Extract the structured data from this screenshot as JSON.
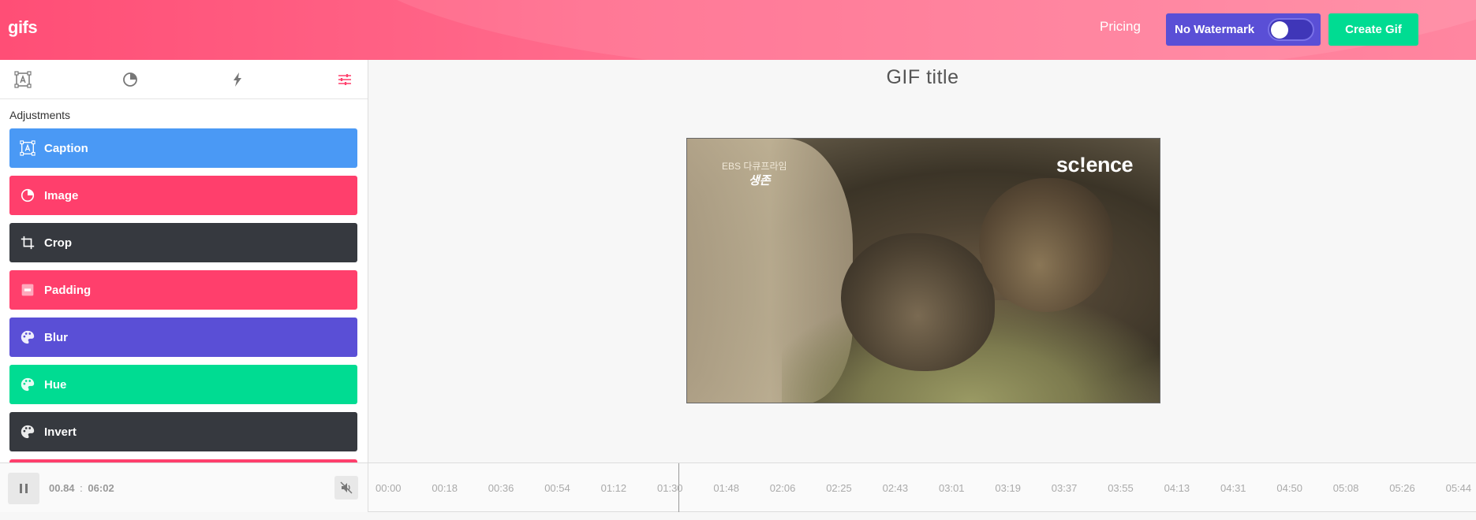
{
  "header": {
    "logo": "gifs",
    "pricing_label": "Pricing",
    "no_watermark_label": "No Watermark",
    "create_label": "Create Gif",
    "toggle_on": false
  },
  "sidebar": {
    "tabs": [
      {
        "name": "caption-tab",
        "icon": "text-box-icon",
        "active": false
      },
      {
        "name": "image-tab",
        "icon": "pie-icon",
        "active": false
      },
      {
        "name": "effects-tab",
        "icon": "lightning-icon",
        "active": false
      },
      {
        "name": "adjustments-tab",
        "icon": "sliders-icon",
        "active": true
      }
    ],
    "section_title": "Adjustments",
    "items": [
      {
        "label": "Caption",
        "color": "#4a99f5",
        "icon": "text-box-icon"
      },
      {
        "label": "Image",
        "color": "#ff3f6c",
        "icon": "pie-icon"
      },
      {
        "label": "Crop",
        "color": "#36393f",
        "icon": "crop-icon"
      },
      {
        "label": "Padding",
        "color": "#ff3f6c",
        "icon": "padding-icon"
      },
      {
        "label": "Blur",
        "color": "#5a4fd6",
        "icon": "palette-icon"
      },
      {
        "label": "Hue",
        "color": "#00dc92",
        "icon": "palette-icon"
      },
      {
        "label": "Invert",
        "color": "#36393f",
        "icon": "palette-icon"
      }
    ]
  },
  "main": {
    "title": "GIF title",
    "video_overlay": {
      "channel": "EBS 다큐프라임",
      "program": "생존",
      "brand": "sc!ence"
    }
  },
  "player": {
    "current_time": "00.84",
    "separator": ":",
    "duration": "06:02",
    "ticks": [
      "00:00",
      "00:18",
      "00:36",
      "00:54",
      "01:12",
      "01:30",
      "01:48",
      "02:06",
      "02:25",
      "02:43",
      "03:01",
      "03:19",
      "03:37",
      "03:55",
      "04:13",
      "04:31",
      "04:50",
      "05:08",
      "05:26",
      "05:44"
    ]
  },
  "colors": {
    "accent": "#ff4e76",
    "purple": "#5a4fd6",
    "green": "#00dc92"
  }
}
